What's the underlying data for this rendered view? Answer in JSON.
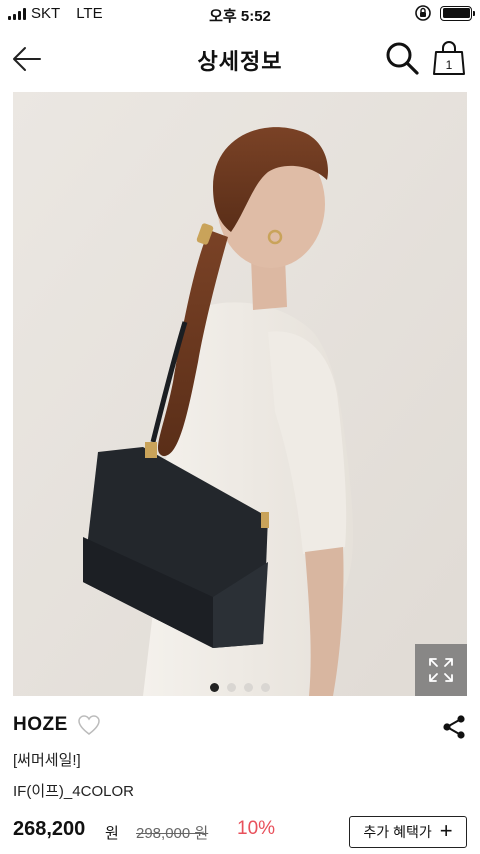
{
  "status_bar": {
    "carrier": "SKT",
    "network": "LTE",
    "time": "오후 5:52"
  },
  "nav": {
    "title": "상세정보",
    "cart_count": "1"
  },
  "gallery": {
    "image_count": 4,
    "active_index": 0
  },
  "product": {
    "brand": "HOZE",
    "tag": "[써머세일!]",
    "name": "IF(이프)_4COLOR",
    "price": "268,200",
    "price_unit": "원",
    "original_price": "298,000 원",
    "discount": "10%",
    "benefit_button": "추가 혜택가"
  },
  "colors": {
    "discount": "#e8505b",
    "text": "#111111",
    "background": "#ffffff"
  }
}
